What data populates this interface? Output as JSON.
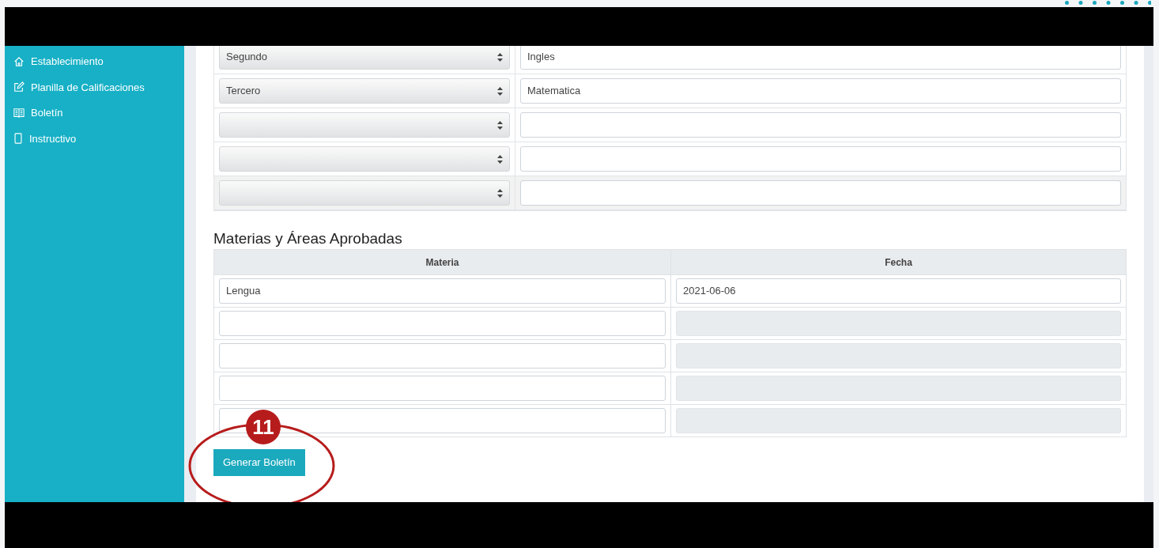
{
  "sidebar": {
    "items": [
      {
        "label": "Establecimiento"
      },
      {
        "label": "Planilla de Calificaciones"
      },
      {
        "label": "Boletín"
      },
      {
        "label": "Instructivo"
      }
    ]
  },
  "period_table": {
    "rows": [
      {
        "period": "Segundo",
        "subject": "Ingles"
      },
      {
        "period": "Tercero",
        "subject": "Matematica"
      },
      {
        "period": null,
        "subject": null
      },
      {
        "period": null,
        "subject": null
      },
      {
        "period": null,
        "subject": null
      }
    ]
  },
  "approved": {
    "title": "Materias y Áreas Aprobadas",
    "columns": [
      "Materia",
      "Fecha"
    ],
    "rows": [
      {
        "materia": "Lengua",
        "fecha": "2021-06-06",
        "fecha_disabled": false
      },
      {
        "materia": null,
        "fecha": null,
        "fecha_disabled": true
      },
      {
        "materia": null,
        "fecha": null,
        "fecha_disabled": true
      },
      {
        "materia": null,
        "fecha": null,
        "fecha_disabled": true
      },
      {
        "materia": null,
        "fecha": null,
        "fecha_disabled": true
      }
    ]
  },
  "button": "Generar Boletín",
  "annotation": {
    "number": "11"
  }
}
